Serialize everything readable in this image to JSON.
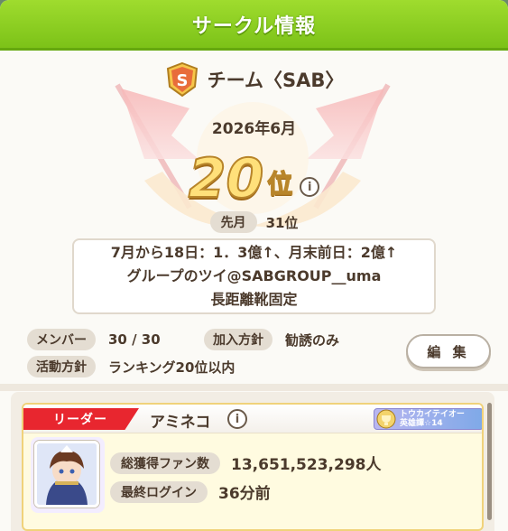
{
  "window": {
    "title": "サークル情報"
  },
  "team": {
    "name": "チーム〈SAB〉",
    "badge_letter": "S"
  },
  "ranking": {
    "month": "2026年6月",
    "rank": "20",
    "rank_suffix": "位",
    "info_icon": "i",
    "last_month_label": "先月",
    "last_month_value": "31位"
  },
  "message": {
    "lines": [
      "7月から18日：1．3億↑、月末前日：2億↑",
      "グループのツイ@SABGROUP__uma",
      "長距離靴固定"
    ]
  },
  "stats": {
    "members_label": "メンバー",
    "members_value": "30 / 30",
    "join_label": "加入方針",
    "join_value": "勧誘のみ",
    "activity_label": "活動方針",
    "activity_value": "ランキング20位以内"
  },
  "edit_button": "編 集",
  "leader": {
    "tag": "リーダー",
    "name": "アミネコ",
    "info_icon": "i",
    "title_badge_line1": "トウカイテイオー",
    "title_badge_line2": "英雄譚☆14",
    "fans_label": "総獲得ファン数",
    "fans_value": "13,651,523,298人",
    "login_label": "最終ログイン",
    "login_value": "36分前"
  },
  "colors": {
    "title_green": "#8fd025",
    "leader_red": "#e8262f",
    "gold": "#ffe07a"
  }
}
